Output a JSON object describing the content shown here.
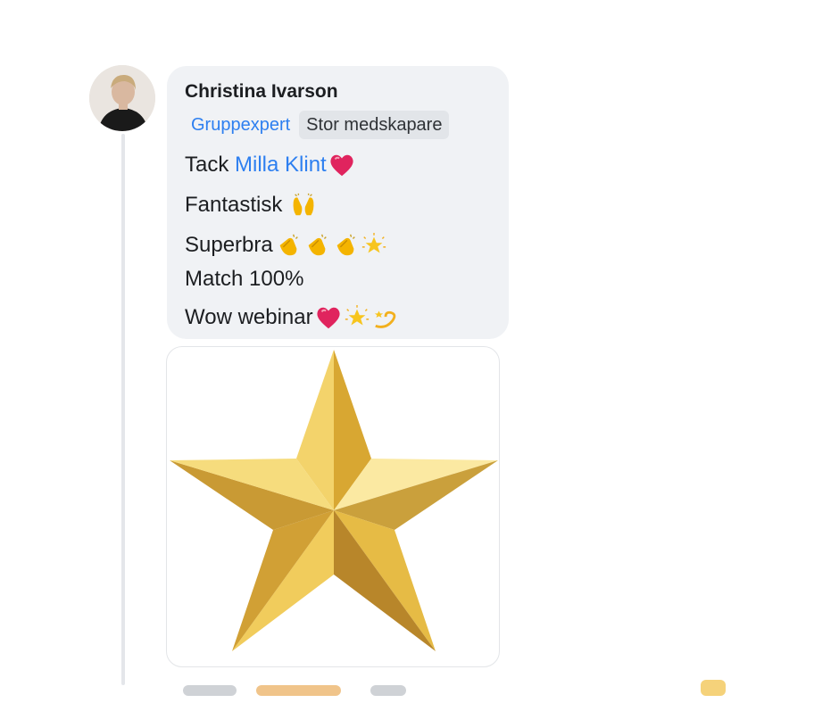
{
  "comment": {
    "author": "Christina Ivarson",
    "badges": {
      "role": "Gruppexpert",
      "tag": "Stor medskapare"
    },
    "lines": {
      "tack_prefix": "Tack ",
      "mention": "Milla Klint",
      "line2": "Fantastisk ",
      "line3": "Superbra",
      "line4": "Match 100%",
      "line5": "Wow webinar"
    },
    "emojis": {
      "line1": [
        "red-heart"
      ],
      "line2": [
        "raising-hands"
      ],
      "line3": [
        "clapping-hands",
        "clapping-hands",
        "clapping-hands",
        "glowing-star"
      ],
      "line5": [
        "red-heart",
        "glowing-star",
        "dizzy"
      ]
    },
    "attachment": {
      "image": "gold-star-icon"
    }
  },
  "colors": {
    "bubble_bg": "#f0f2f5",
    "link_blue": "#2d7ff0",
    "text": "#1c1e21",
    "heart_red": "#e0245e",
    "gold": "#d4a72c"
  }
}
